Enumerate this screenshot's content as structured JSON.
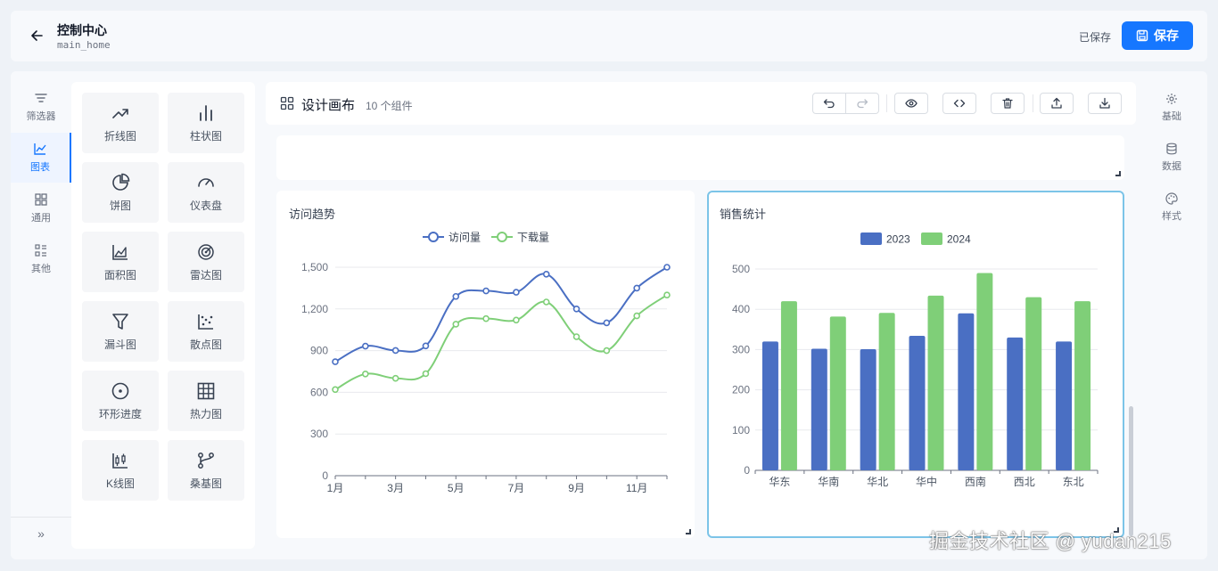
{
  "header": {
    "title": "控制中心",
    "subtitle": "main_home",
    "saved_status": "已保存",
    "save_label": "保存"
  },
  "left_rail": {
    "items": [
      {
        "label": "筛选器",
        "icon": "filter-icon"
      },
      {
        "label": "图表",
        "icon": "chart-line-icon",
        "active": true
      },
      {
        "label": "通用",
        "icon": "grid-icon"
      },
      {
        "label": "其他",
        "icon": "list-icon"
      }
    ],
    "collapse": "»"
  },
  "palette": {
    "items": [
      {
        "label": "折线图",
        "icon": "trend-icon"
      },
      {
        "label": "柱状图",
        "icon": "bar-chart-icon"
      },
      {
        "label": "饼图",
        "icon": "pie-chart-icon"
      },
      {
        "label": "仪表盘",
        "icon": "gauge-icon"
      },
      {
        "label": "面积图",
        "icon": "area-chart-icon"
      },
      {
        "label": "雷达图",
        "icon": "radar-icon"
      },
      {
        "label": "漏斗图",
        "icon": "funnel-icon"
      },
      {
        "label": "散点图",
        "icon": "scatter-icon"
      },
      {
        "label": "环形进度",
        "icon": "ring-progress-icon"
      },
      {
        "label": "热力图",
        "icon": "heatmap-icon"
      },
      {
        "label": "K线图",
        "icon": "candlestick-icon"
      },
      {
        "label": "桑基图",
        "icon": "sankey-icon"
      }
    ]
  },
  "toolbar": {
    "title": "设计画布",
    "count": "10 个组件"
  },
  "right_rail": {
    "items": [
      {
        "label": "基础",
        "icon": "gear-icon"
      },
      {
        "label": "数据",
        "icon": "database-icon"
      },
      {
        "label": "样式",
        "icon": "palette-icon"
      }
    ]
  },
  "watermark": "掘金技术社区 @ yudan215",
  "colors": {
    "accent": "#1677ff",
    "series_blue": "#4a6fc3",
    "series_green": "#7fcf78"
  },
  "chart_data": [
    {
      "type": "line",
      "title": "访问趋势",
      "x": [
        "1月",
        "2月",
        "3月",
        "4月",
        "5月",
        "6月",
        "7月",
        "8月",
        "9月",
        "10月",
        "11月",
        "12月"
      ],
      "x_tick_labels": [
        "1月",
        "3月",
        "5月",
        "7月",
        "9月",
        "11月"
      ],
      "series": [
        {
          "name": "访问量",
          "values": [
            820,
            932,
            901,
            934,
            1290,
            1330,
            1320,
            1450,
            1200,
            1100,
            1350,
            1500
          ]
        },
        {
          "name": "下载量",
          "values": [
            620,
            732,
            701,
            734,
            1090,
            1130,
            1120,
            1250,
            1000,
            900,
            1150,
            1300
          ]
        }
      ],
      "ylim": [
        0,
        1500
      ],
      "yticks": [
        0,
        300,
        600,
        900,
        1200,
        1500
      ],
      "grid": true,
      "smooth": true,
      "legend": "top-center"
    },
    {
      "type": "bar",
      "title": "销售统计",
      "categories": [
        "华东",
        "华南",
        "华北",
        "华中",
        "西南",
        "西北",
        "东北"
      ],
      "series": [
        {
          "name": "2023",
          "values": [
            320,
            302,
            301,
            334,
            390,
            330,
            320
          ]
        },
        {
          "name": "2024",
          "values": [
            420,
            382,
            391,
            434,
            490,
            430,
            420
          ]
        }
      ],
      "ylim": [
        0,
        500
      ],
      "yticks": [
        0,
        100,
        200,
        300,
        400,
        500
      ],
      "grid": true,
      "legend": "top-center"
    }
  ]
}
